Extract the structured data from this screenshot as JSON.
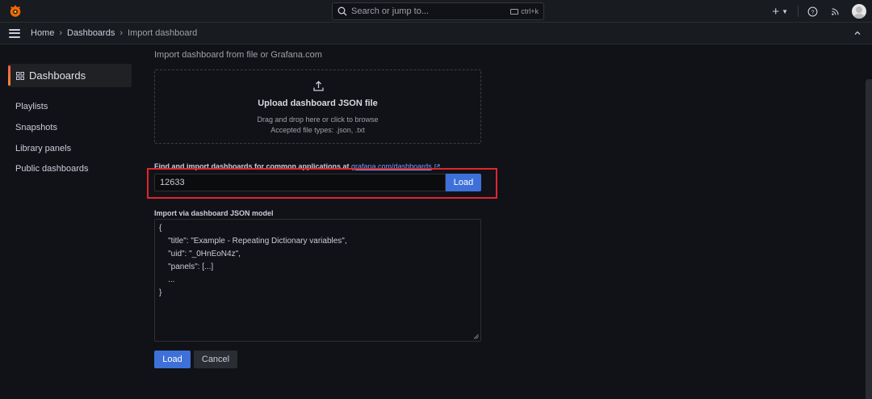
{
  "topbar": {
    "search_placeholder": "Search or jump to...",
    "shortcut": "ctrl+k",
    "add_label": "+"
  },
  "breadcrumb": {
    "items": [
      "Home",
      "Dashboards",
      "Import dashboard"
    ]
  },
  "sidebar": {
    "active_label": "Dashboards",
    "items": [
      {
        "label": "Playlists"
      },
      {
        "label": "Snapshots"
      },
      {
        "label": "Library panels"
      },
      {
        "label": "Public dashboards"
      }
    ]
  },
  "main": {
    "section_title": "Import dashboard from file or Grafana.com",
    "upload": {
      "title": "Upload dashboard JSON file",
      "hint": "Drag and drop here or click to browse",
      "accepted": "Accepted file types: .json, .txt"
    },
    "find": {
      "label_prefix": "Find and import dashboards for common applications at ",
      "link_text": "grafana.com/dashboards",
      "input_value": "12633",
      "load_label": "Load"
    },
    "json_model": {
      "label": "Import via dashboard JSON model",
      "lines": [
        "{",
        "    \"title\": \"Example - Repeating Dictionary variables\",",
        "    \"uid\": \"_0HnEoN4z\",",
        "    \"panels\": [...]",
        "    ...",
        "}"
      ]
    },
    "buttons": {
      "load": "Load",
      "cancel": "Cancel"
    }
  },
  "colors": {
    "accent": "#3d71d9",
    "highlight": "#e0272d",
    "active_bar": "#f55f3e"
  }
}
